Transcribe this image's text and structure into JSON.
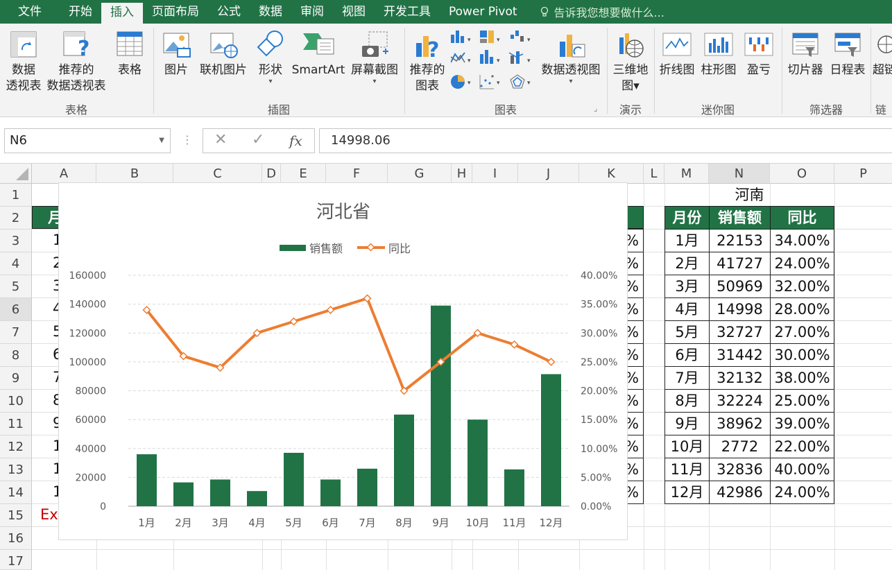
{
  "ribbon_tabs": [
    "文件",
    "开始",
    "插入",
    "页面布局",
    "公式",
    "数据",
    "审阅",
    "视图",
    "开发工具",
    "Power Pivot"
  ],
  "active_tab": "插入",
  "tell_me": "告诉我您想要做什么...",
  "ribbon": {
    "pivot_table": [
      "数据",
      "透视表"
    ],
    "recommended_pivot": [
      "推荐的",
      "数据透视表"
    ],
    "table": "表格",
    "group_tables": "表格",
    "pictures": "图片",
    "online_pictures": "联机图片",
    "shapes": "形状",
    "smartart": "SmartArt",
    "screenshot": "屏幕截图",
    "group_illustrations": "插图",
    "recommended_charts": [
      "推荐的",
      "图表"
    ],
    "pivot_chart": "数据透视图",
    "group_charts": "图表",
    "map_3d": [
      "三维地",
      "图"
    ],
    "group_tours": "演示",
    "sparkline_line": "折线图",
    "sparkline_column": "柱形图",
    "sparkline_winloss": "盈亏",
    "group_sparklines": "迷你图",
    "slicer": "切片器",
    "timeline": "日程表",
    "group_filters": "筛选器",
    "hyperlink": "超链",
    "group_links": "链"
  },
  "name_box": "N6",
  "formula_value": "14998.06",
  "columns": [
    "A",
    "B",
    "C",
    "D",
    "E",
    "F",
    "G",
    "H",
    "I",
    "J",
    "K",
    "L",
    "M",
    "N",
    "O",
    "P"
  ],
  "rows": [
    "1",
    "2",
    "3",
    "4",
    "5",
    "6",
    "7",
    "8",
    "9",
    "10",
    "11",
    "12",
    "13",
    "14",
    "15",
    "16",
    "17"
  ],
  "left_table": {
    "header_partial": "月",
    "month_partial": [
      "1",
      "2",
      "3",
      "4",
      "5",
      "6",
      "7",
      "8",
      "9",
      "1(",
      "1",
      "1:"
    ],
    "a15_partial": "Ex",
    "k_col_partial": "%"
  },
  "henan_table": {
    "title": "河南",
    "headers": [
      "月份",
      "销售额",
      "同比"
    ],
    "rows": [
      [
        "1月",
        "22153",
        "34.00%"
      ],
      [
        "2月",
        "41727",
        "24.00%"
      ],
      [
        "3月",
        "50969",
        "32.00%"
      ],
      [
        "4月",
        "14998",
        "28.00%"
      ],
      [
        "5月",
        "32727",
        "27.00%"
      ],
      [
        "6月",
        "31442",
        "30.00%"
      ],
      [
        "7月",
        "32132",
        "38.00%"
      ],
      [
        "8月",
        "32224",
        "25.00%"
      ],
      [
        "9月",
        "38962",
        "39.00%"
      ],
      [
        "10月",
        "2772",
        "22.00%"
      ],
      [
        "11月",
        "32836",
        "40.00%"
      ],
      [
        "12月",
        "42986",
        "24.00%"
      ]
    ]
  },
  "colors": {
    "excel_green": "#217346",
    "bar_green": "#217346",
    "line_orange": "#ED7D31"
  },
  "chart_data": {
    "type": "bar",
    "title": "河北省",
    "categories": [
      "1月",
      "2月",
      "3月",
      "4月",
      "5月",
      "6月",
      "7月",
      "8月",
      "9月",
      "10月",
      "11月",
      "12月"
    ],
    "series": [
      {
        "name": "销售额",
        "type": "bar",
        "axis": "left",
        "values": [
          36000,
          16500,
          18500,
          10500,
          37000,
          18500,
          26000,
          63500,
          139000,
          60000,
          25500,
          91500
        ]
      },
      {
        "name": "同比",
        "type": "line",
        "axis": "right",
        "values": [
          0.34,
          0.26,
          0.24,
          0.3,
          0.32,
          0.34,
          0.36,
          0.2,
          0.25,
          0.3,
          0.28,
          0.25
        ]
      }
    ],
    "ylim": [
      0,
      160000
    ],
    "yticks": [
      "0",
      "20000",
      "40000",
      "60000",
      "80000",
      "100000",
      "120000",
      "140000",
      "160000"
    ],
    "y2lim": [
      0,
      0.4
    ],
    "y2ticks": [
      "0.00%",
      "5.00%",
      "10.00%",
      "15.00%",
      "20.00%",
      "25.00%",
      "30.00%",
      "35.00%",
      "40.00%"
    ],
    "legend": "top",
    "grid": true
  }
}
